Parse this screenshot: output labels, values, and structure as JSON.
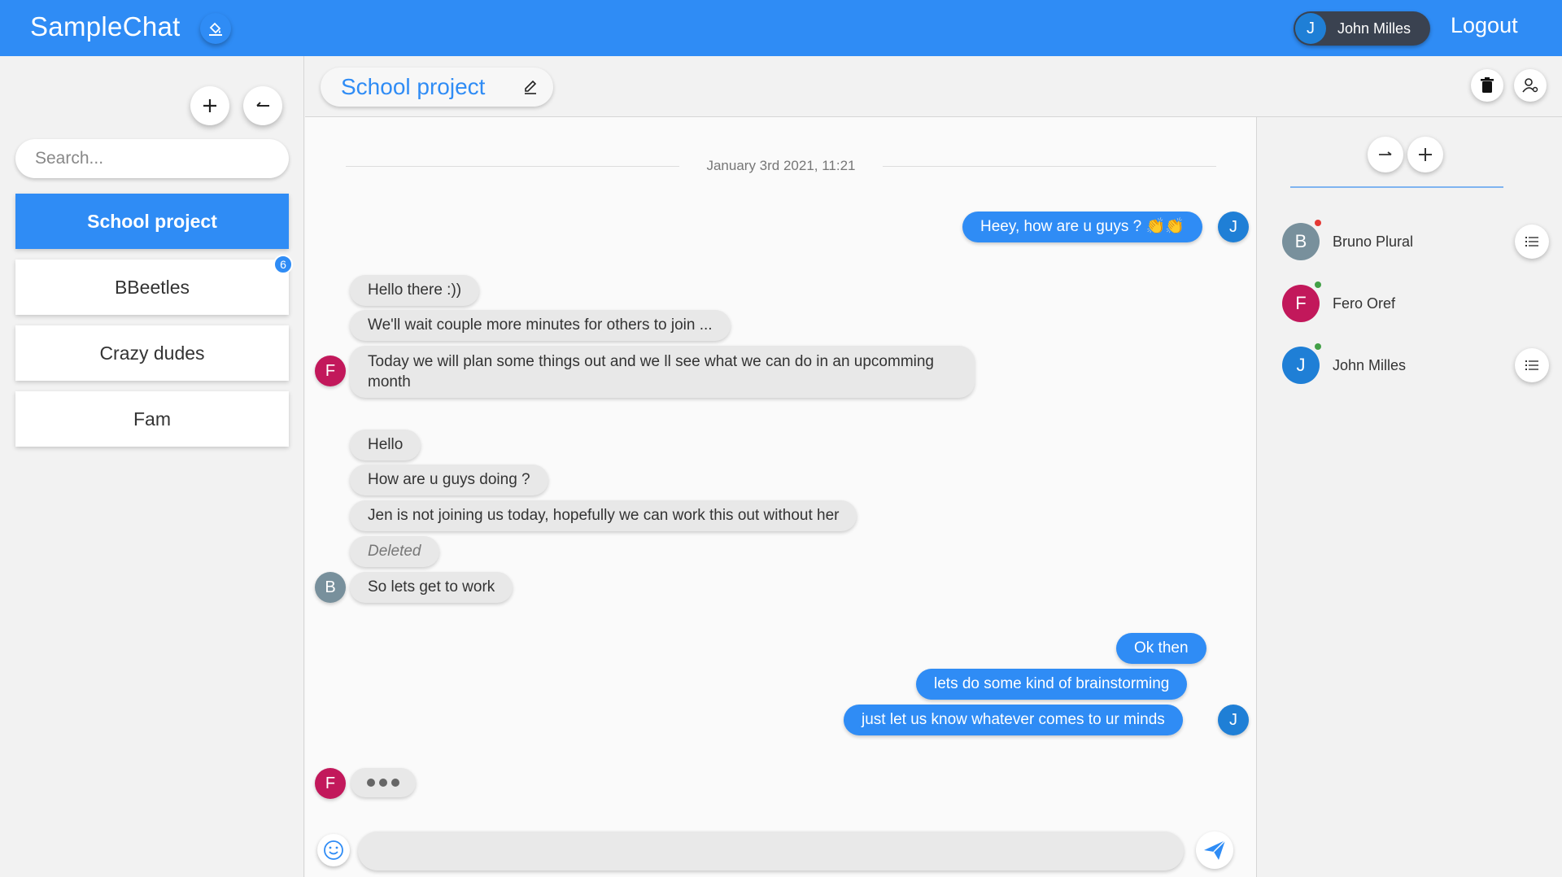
{
  "app": {
    "title": "SampleChat",
    "user_name": "John Milles",
    "user_initial": "J",
    "logout_label": "Logout",
    "accent_color": "#2f8cf5"
  },
  "sidebar": {
    "add_icon": "plus-icon",
    "collapse_icon": "arrow-left-icon",
    "search_placeholder": "Search...",
    "rooms": [
      {
        "label": "School project",
        "active": true
      },
      {
        "label": "BBeetles",
        "unread": "6"
      },
      {
        "label": "Crazy dudes"
      },
      {
        "label": "Fam"
      }
    ]
  },
  "chat": {
    "title": "School project",
    "date_separator": "January 3rd 2021, 11:21",
    "messages": {
      "m1": "Heey, how are u guys ? 👏👏",
      "m2": "Hello there :))",
      "m3": "We'll wait couple more minutes for others to join ...",
      "m4": "Today we will plan some things out and we ll see what we can do in an upcomming month",
      "m5": "Hello",
      "m6": "How are u guys doing ?",
      "m7": "Jen is not joining us today, hopefully we can work this out without her",
      "m8": "Deleted",
      "m9": "So lets get to work",
      "m10": "Ok then",
      "m11": "lets do some kind of brainstorming",
      "m12": "just let us know whatever comes to ur minds"
    },
    "avatars": {
      "j": "J",
      "f": "F",
      "b": "B"
    },
    "composer_value": ""
  },
  "members": [
    {
      "name": "Bruno Plural",
      "initial": "B",
      "color": "#78909c",
      "status_color": "#e53935"
    },
    {
      "name": "Fero Oref",
      "initial": "F",
      "color": "#c2185b",
      "status_color": "#43a047"
    },
    {
      "name": "John Milles",
      "initial": "J",
      "color": "#1f7fd6",
      "status_color": "#43a047"
    }
  ]
}
